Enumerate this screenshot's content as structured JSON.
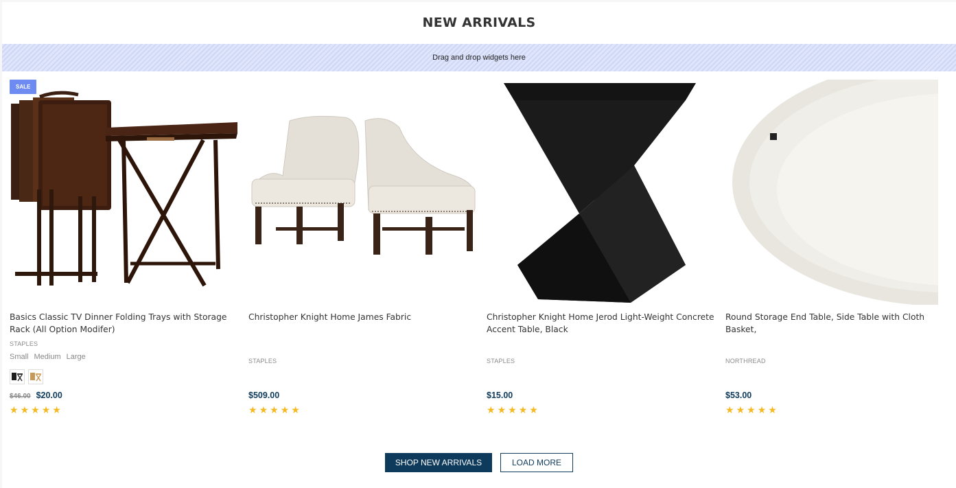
{
  "section": {
    "title": "NEW ARRIVALS",
    "dropzone_text": "Drag and drop widgets here"
  },
  "products": [
    {
      "name": "Basics Classic TV Dinner Folding Trays with Storage Rack (All Option Modifer)",
      "brand": "STAPLES",
      "badge": "SALE",
      "sizes": [
        "Small",
        "Medium",
        "Large"
      ],
      "old_price": "$46.00",
      "price": "$20.00",
      "rating": 5,
      "image_icon": "folding-tray-table-image"
    },
    {
      "name": "Christopher Knight Home James Fabric",
      "brand": "STAPLES",
      "price": "$509.00",
      "rating": 5,
      "image_icon": "fabric-chairs-image"
    },
    {
      "name": "Christopher Knight Home Jerod Light-Weight Concrete Accent Table, Black",
      "brand": "STAPLES",
      "price": "$15.00",
      "rating": 5,
      "image_icon": "black-accent-table-image"
    },
    {
      "name": "Round Storage End Table, Side Table with Cloth Basket,",
      "brand": "NORTHREAD",
      "price": "$53.00",
      "rating": 5,
      "image_icon": "round-white-table-image"
    }
  ],
  "buttons": {
    "shop": "SHOP NEW ARRIVALS",
    "load_more": "LOAD MORE"
  },
  "colors": {
    "primary": "#0e3a5b",
    "sale_badge": "#6d8bf0",
    "star": "#f5b920"
  }
}
